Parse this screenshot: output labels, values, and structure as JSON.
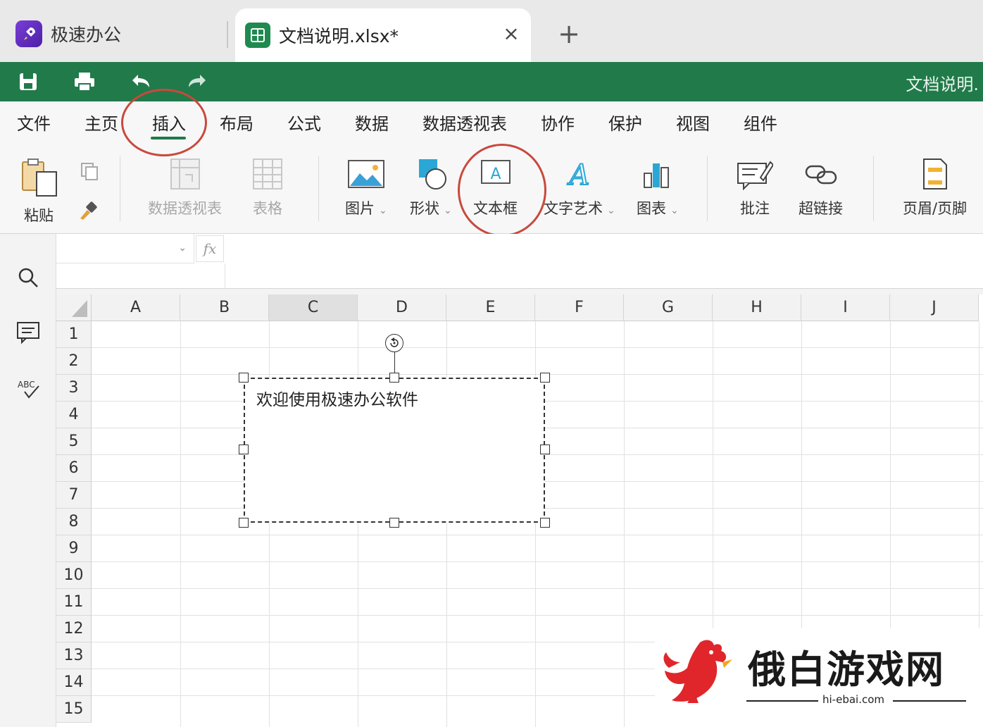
{
  "tabs": {
    "app_name": "极速办公",
    "doc_name": "文档说明.xlsx*",
    "close": "×",
    "new_tab": "+"
  },
  "quickbar": {
    "title": "文档说明."
  },
  "menu": {
    "items": [
      "文件",
      "主页",
      "插入",
      "布局",
      "公式",
      "数据",
      "数据透视表",
      "协作",
      "保护",
      "视图",
      "组件"
    ],
    "active": "插入"
  },
  "ribbon": {
    "paste": "粘贴",
    "pivot_table": "数据透视表",
    "table": "表格",
    "picture": "图片",
    "shape": "形状",
    "text_box": "文本框",
    "word_art": "文字艺术",
    "chart": "图表",
    "comment": "批注",
    "hyperlink": "超链接",
    "header_footer": "页眉/页脚",
    "caret": "⌄"
  },
  "formula_bar": {
    "name_box": "",
    "fx": "fx"
  },
  "grid": {
    "columns": [
      "A",
      "B",
      "C",
      "D",
      "E",
      "F",
      "G",
      "H",
      "I",
      "J"
    ],
    "selected_column": "C",
    "rows": [
      "1",
      "2",
      "3",
      "4",
      "5",
      "6",
      "7",
      "8",
      "9",
      "10",
      "11",
      "12",
      "13",
      "14",
      "15"
    ]
  },
  "textbox": {
    "text": "欢迎使用极速办公软件"
  },
  "watermark": {
    "title": "俄白游戏网",
    "url": "hi-ebai.com"
  },
  "colors": {
    "brand_green": "#217a4a",
    "annotation_red": "#c8493d",
    "app_purple": "#5b2bbd"
  }
}
